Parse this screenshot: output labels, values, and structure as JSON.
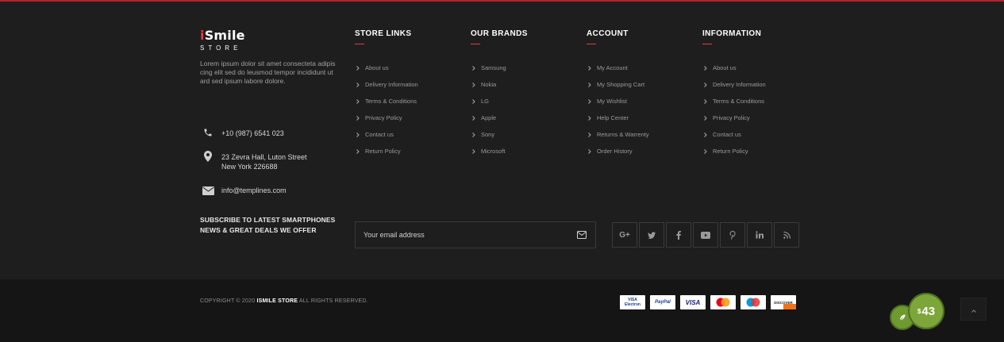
{
  "logo": {
    "brand_prefix": "i",
    "brand_rest": "Smile",
    "sub": "STORE"
  },
  "about_text": "Lorem ipsum dolor sit amet consecteta adipis cing elit sed do leusmod tempor incididunt ut ard sed ipsum labore dolore.",
  "contact": {
    "phone": "+10 (987) 6541 023",
    "address_line1": "23 Zevra Hall, Luton Street",
    "address_line2": "New York 226688",
    "email": "info@templines.com"
  },
  "subscribe": {
    "title_line1": "SUBSCRIBE TO LATEST SMARTPHONES",
    "title_line2": "NEWS & GREAT DEALS WE OFFER",
    "placeholder": "Your email address"
  },
  "columns": [
    {
      "title": "STORE LINKS",
      "items": [
        "About us",
        "Delivery Information",
        "Terms & Conditions",
        "Privacy Policy",
        "Contact us",
        "Return Policy"
      ]
    },
    {
      "title": "OUR BRANDS",
      "items": [
        "Samsung",
        "Nokia",
        "LG",
        "Apple",
        "Sony",
        "Microsoft"
      ]
    },
    {
      "title": "ACCOUNT",
      "items": [
        "My Account",
        "My Shopping Cart",
        "My Wishlist",
        "Help Center",
        "Returns & Warrenty",
        "Order History"
      ]
    },
    {
      "title": "INFORMATION",
      "items": [
        "About us",
        "Delivery Information",
        "Terms & Conditions",
        "Privacy Policy",
        "Contact us",
        "Return Policy"
      ]
    }
  ],
  "social": {
    "google_label": "G+",
    "icons": [
      "google-plus-icon",
      "twitter-icon",
      "facebook-icon",
      "youtube-icon",
      "pinterest-icon",
      "linkedin-icon",
      "rss-icon"
    ]
  },
  "copyright": {
    "prefix": "COPYRIGHT © 2020",
    "brand": "ISMILE STORE",
    "suffix": "ALL RIGHTS RESERVED."
  },
  "payments": {
    "visa_electron": [
      "VISA",
      "Electron"
    ],
    "paypal": "PayPal",
    "visa": "VISA",
    "discover": "DISCOVER"
  },
  "price_badge": {
    "currency": "$",
    "amount": "43"
  },
  "colors": {
    "accent": "#e53a3a",
    "badge_green": "#7da63a",
    "background": "#1e1e1e",
    "bottom_bar": "#151515"
  }
}
